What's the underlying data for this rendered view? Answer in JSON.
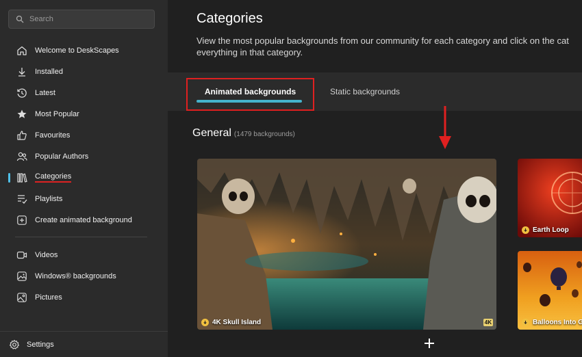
{
  "search": {
    "placeholder": "Search"
  },
  "sidebar": {
    "items": [
      {
        "label": "Welcome to DeskScapes",
        "icon": "home-icon"
      },
      {
        "label": "Installed",
        "icon": "download-icon"
      },
      {
        "label": "Latest",
        "icon": "history-icon"
      },
      {
        "label": "Most Popular",
        "icon": "star-icon"
      },
      {
        "label": "Favourites",
        "icon": "thumbs-up-icon"
      },
      {
        "label": "Popular Authors",
        "icon": "people-icon"
      },
      {
        "label": "Categories",
        "icon": "library-icon"
      },
      {
        "label": "Playlists",
        "icon": "playlist-icon"
      },
      {
        "label": "Create animated background",
        "icon": "add-square-icon"
      }
    ],
    "media_items": [
      {
        "label": "Videos",
        "icon": "video-icon"
      },
      {
        "label": "Windows® backgrounds",
        "icon": "image-icon"
      },
      {
        "label": "Pictures",
        "icon": "picture-icon"
      }
    ],
    "settings_label": "Settings",
    "active": "Categories"
  },
  "main": {
    "title": "Categories",
    "description_line1": "View the most popular backgrounds from our community for each category and click on the cat",
    "description_line2": "everything in that category.",
    "tabs": [
      {
        "label": "Animated backgrounds",
        "selected": true
      },
      {
        "label": "Static backgrounds",
        "selected": false
      }
    ],
    "section_title": "General",
    "section_count": "(1479 backgrounds)",
    "cards": [
      {
        "label": "4K Skull Island",
        "badge": "4K"
      },
      {
        "label": "Earth Loop"
      },
      {
        "label": "Balloons Into G"
      }
    ]
  },
  "colors": {
    "accent": "#45b3cc",
    "highlight": "#e02020"
  }
}
